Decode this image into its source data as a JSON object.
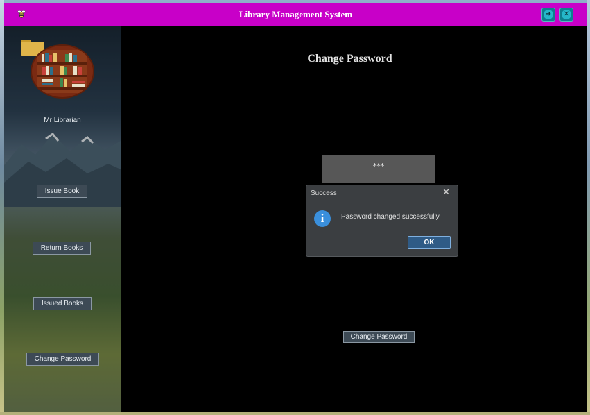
{
  "window": {
    "title": "Library Management System",
    "minimize_glyph": "➜",
    "close_glyph": "✕"
  },
  "sidebar": {
    "user_name": "Mr Librarian",
    "buttons": [
      {
        "label": "Issue Book"
      },
      {
        "label": "Return Books"
      },
      {
        "label": "Issued Books"
      },
      {
        "label": "Change Password"
      }
    ]
  },
  "main": {
    "heading": "Change Password",
    "password_value": "***",
    "submit_label": "Change Password"
  },
  "dialog": {
    "title": "Success",
    "close_glyph": "✕",
    "info_glyph": "i",
    "message": "Password changed successfully",
    "ok_label": "OK"
  },
  "colors": {
    "titlebar": "#c800c8",
    "background": "#000000",
    "dialog": "#3b3e41",
    "accent": "#3a8fdc"
  },
  "icons": {
    "app": "bee-icon",
    "minimize": "arrow-icon",
    "close": "close-icon",
    "dialog": "info-icon"
  }
}
